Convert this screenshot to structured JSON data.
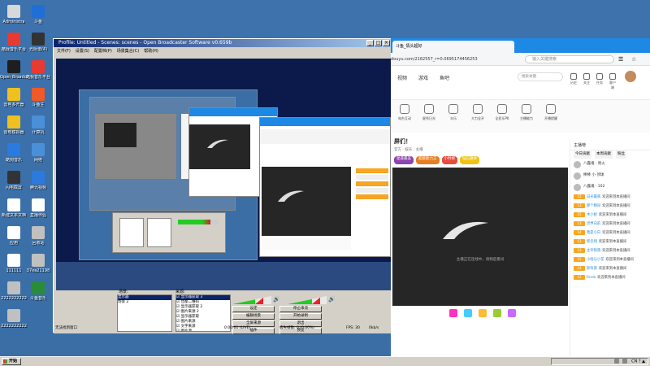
{
  "desktop": {
    "icons": [
      {
        "label": "Administra",
        "color": "#d8d8d8"
      },
      {
        "label": "斗鱼",
        "color": "#1f6fd6"
      },
      {
        "label": "酷我音乐平台",
        "color": "#e83a30"
      },
      {
        "label": "光阴谱(4)",
        "color": "#333333"
      },
      {
        "label": "Open Broadcaster",
        "color": "#1e1e1e"
      },
      {
        "label": "酷我音乐平台",
        "color": "#e83a30"
      },
      {
        "label": "雷电多开器",
        "color": "#f0c020"
      },
      {
        "label": "斗鱼主",
        "color": "#f05a28"
      },
      {
        "label": "雷电模拟器",
        "color": "#f0c020"
      },
      {
        "label": "计算机",
        "color": "#4a90d9"
      },
      {
        "label": "酷狗音乐",
        "color": "#2a7ae0"
      },
      {
        "label": "网络",
        "color": "#4a90d9"
      },
      {
        "label": "闪电截屏",
        "color": "#333333"
      },
      {
        "label": "腾讯视频",
        "color": "#2a7ae0"
      },
      {
        "label": "新建文本文档",
        "color": "#ffffff"
      },
      {
        "label": "直播伴侣",
        "color": "#ffffff"
      },
      {
        "label": "应用",
        "color": "#ffffff"
      },
      {
        "label": "回收站",
        "color": "#c0c0c0"
      },
      {
        "label": "111111",
        "color": "#ffffff"
      },
      {
        "label": "37ea21198",
        "color": "#c0c0c0"
      },
      {
        "label": "2222222222",
        "color": "#c0c0c0"
      },
      {
        "label": "斗鱼音乐",
        "color": "#2a8c3a"
      },
      {
        "label": "2222222222",
        "color": "#c0c0c0"
      }
    ]
  },
  "obs": {
    "title": "Profile: Untitled - Scenes: scenes - Open Broadcaster Software v0.659b",
    "menu": [
      "文件(F)",
      "设置(S)",
      "配置档(P)",
      "场景集合(C)",
      "帮助(H)"
    ],
    "scenes_label": "场景:",
    "sources_label": "来源:",
    "scenes": [
      "显示器",
      "场景 2"
    ],
    "sources": [
      "显示器获取 3",
      "佳都二维码",
      "显示器获取 2",
      "图片来源 2",
      "显示器获取",
      "图片来源",
      "文字来源",
      "图片源",
      "显示器获取"
    ],
    "buttons": [
      "设定",
      "停止串流",
      "编辑场景",
      "开始录制",
      "全屏来源",
      "退出",
      "插件",
      "预览"
    ],
    "status_left": "无法找到窗口",
    "status_time": "0:00:01 (LIVE)",
    "status_dropped": "丢失帧数: 0 (0.00%)",
    "status_fps": "FPS: 30",
    "status_kbps": "0kb/s"
  },
  "browser": {
    "tab_title": "斗鱼_情头超好",
    "url": "douyu.com/2162557_r=0.0695174456253",
    "search_placeholder": "输入关键搜索",
    "nav": [
      "视频",
      "游戏",
      "鱼吧"
    ],
    "site_search_placeholder": "搜索关键",
    "header_icons": [
      "历史",
      "关注",
      "任务",
      "客户端"
    ],
    "categories": [
      "电台互动",
      "星秀日光",
      "丰乐",
      "大力全开",
      "全民乐PK",
      "主播能力",
      "开播提醒"
    ],
    "room_title": "屏们！",
    "room_meta": "官方 · 娱乐 · 主播",
    "room_tags": [
      "星座最美",
      "超级能力王",
      "小时榜",
      "钻石徽章"
    ],
    "player_message": "主播正在连线中，请稍后重试",
    "chat": {
      "header": "主播榜",
      "tabs": [
        "今日贡献",
        "本周贡献",
        "粉丝"
      ],
      "ranks": [
        {
          "name": "八露魂 · 周火",
          "score": ""
        },
        {
          "name": "棒棒 小·顶球",
          "score": ""
        },
        {
          "name": "八露魂 · 102",
          "score": ""
        }
      ],
      "messages": [
        {
          "level": "12",
          "name": "日光最萌",
          "text": "欢迎来到本直播间"
        },
        {
          "level": "13",
          "name": "那个瞬间",
          "text": "欢迎来到本直播间"
        },
        {
          "level": "15",
          "name": "木小姐",
          "text": "欢迎来到本直播间"
        },
        {
          "level": "13",
          "name": "世界向前",
          "text": "欢迎来到本直播间"
        },
        {
          "level": "14",
          "name": "我是小白",
          "text": "欢迎来到本直播间"
        },
        {
          "level": "12",
          "name": "新云翔",
          "text": "欢迎来到本直播间"
        },
        {
          "level": "13",
          "name": "主宰陨落",
          "text": "欢迎来到本直播间"
        },
        {
          "level": "15",
          "name": "小雨与小花",
          "text": "欢迎来到本直播间"
        },
        {
          "level": "14",
          "name": "斯科莫",
          "text": "欢迎来到本直播间"
        },
        {
          "level": "12",
          "name": "Rnnb",
          "text": "欢迎来到本直播间"
        }
      ]
    }
  },
  "taskbar": {
    "start_label": "开始",
    "clock": "CN  ?  ▲"
  },
  "colors": {
    "desktop": "#3a6ea5",
    "browser_accent": "#1e88e5",
    "obs_face": "#d4d0c8",
    "level_badge": "#f6a623"
  }
}
